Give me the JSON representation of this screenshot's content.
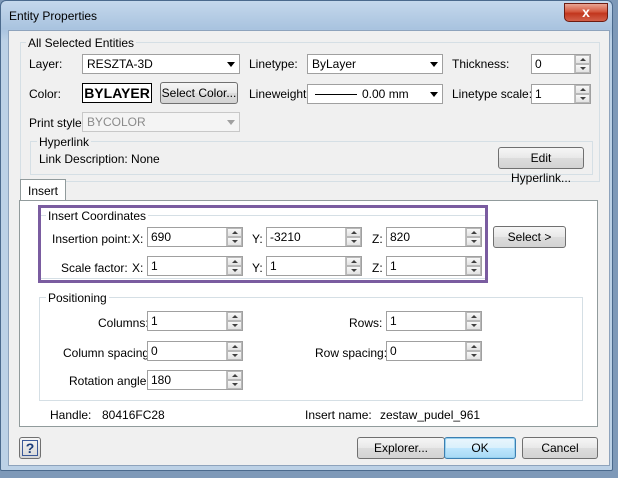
{
  "window": {
    "title": "Entity Properties",
    "close_glyph": "x"
  },
  "common": {
    "group_label": "All Selected Entities",
    "layer": {
      "label": "Layer:",
      "value": "RESZTA-3D"
    },
    "linetype": {
      "label": "Linetype:",
      "value": "ByLayer"
    },
    "thickness": {
      "label": "Thickness:",
      "value": "0"
    },
    "color": {
      "label": "Color:",
      "swatch": "BYLAYER",
      "button": "Select Color..."
    },
    "lineweight": {
      "label": "Lineweight:",
      "value": "0.00 mm"
    },
    "linetype_scale": {
      "label": "Linetype scale:",
      "value": "1"
    },
    "print_style": {
      "label": "Print style:",
      "value": "BYCOLOR"
    },
    "hyperlink": {
      "group_label": "Hyperlink",
      "description": "Link Description: None",
      "button": "Edit Hyperlink..."
    }
  },
  "tabs": [
    {
      "label": "Insert",
      "selected": true
    }
  ],
  "insert": {
    "coords_label": "Insert Coordinates",
    "insertion_point": {
      "label": "Insertion point:",
      "x_label": "X:",
      "x": "690",
      "y_label": "Y:",
      "y": "-3210",
      "z_label": "Z:",
      "z": "820"
    },
    "scale_factor": {
      "label": "Scale factor:",
      "x_label": "X:",
      "x": "1",
      "y_label": "Y:",
      "y": "1",
      "z_label": "Z:",
      "z": "1"
    },
    "select_button": "Select >",
    "positioning_label": "Positioning",
    "columns": {
      "label": "Columns:",
      "value": "1"
    },
    "rows": {
      "label": "Rows:",
      "value": "1"
    },
    "column_spacing": {
      "label": "Column spacing:",
      "value": "0"
    },
    "row_spacing": {
      "label": "Row spacing:",
      "value": "0"
    },
    "rotation_angle": {
      "label": "Rotation angle:",
      "value": "180"
    },
    "handle": {
      "label": "Handle:",
      "value": "80416FC28"
    },
    "insert_name": {
      "label": "Insert name:",
      "value": "zestaw_pudel_961"
    }
  },
  "footer": {
    "help": "?",
    "explorer": "Explorer...",
    "ok": "OK",
    "cancel": "Cancel"
  },
  "colors": {
    "highlight_border": "#7a5ca0",
    "default_button": "#3c7fb1"
  }
}
